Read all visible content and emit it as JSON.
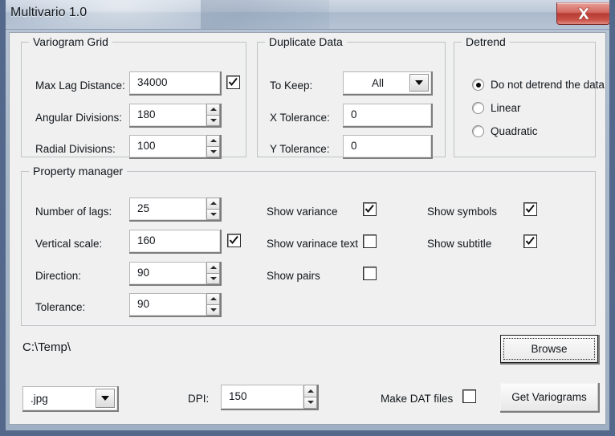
{
  "window": {
    "title": "Multivario 1.0",
    "close_label": "Close",
    "close_icon": "x-icon"
  },
  "variogram_grid": {
    "legend": "Variogram Grid",
    "max_lag_distance": {
      "label": "Max Lag Distance:",
      "value": "34000",
      "checked": true
    },
    "angular_divisions": {
      "label": "Angular Divisions:",
      "value": "180"
    },
    "radial_divisions": {
      "label": "Radial Divisions:",
      "value": "100"
    }
  },
  "duplicate_data": {
    "legend": "Duplicate Data",
    "to_keep": {
      "label": "To Keep:",
      "value": "All"
    },
    "x_tolerance": {
      "label": "X Tolerance:",
      "value": "0"
    },
    "y_tolerance": {
      "label": "Y Tolerance:",
      "value": "0"
    }
  },
  "detrend": {
    "legend": "Detrend",
    "options": [
      {
        "label": "Do not detrend the data",
        "selected": true
      },
      {
        "label": "Linear",
        "selected": false
      },
      {
        "label": "Quadratic",
        "selected": false
      }
    ]
  },
  "property_manager": {
    "legend": "Property manager",
    "number_of_lags": {
      "label": "Number of lags:",
      "value": "25"
    },
    "vertical_scale": {
      "label": "Vertical scale:",
      "value": "160",
      "checked": true
    },
    "direction": {
      "label": "Direction:",
      "value": "90"
    },
    "tolerance": {
      "label": "Tolerance:",
      "value": "90"
    },
    "checkboxes": [
      {
        "label": "Show variance",
        "checked": true
      },
      {
        "label": "Show varinace text",
        "checked": false
      },
      {
        "label": "Show pairs",
        "checked": false
      },
      {
        "label": "Show symbols",
        "checked": true
      },
      {
        "label": "Show subtitle",
        "checked": true
      }
    ]
  },
  "footer": {
    "output_path": "C:\\Temp\\",
    "browse_label": "Browse",
    "file_format": ".jpg",
    "dpi_label": "DPI:",
    "dpi_value": "150",
    "make_dat_label": "Make DAT files",
    "make_dat_checked": false,
    "get_variograms_label": "Get Variograms"
  }
}
